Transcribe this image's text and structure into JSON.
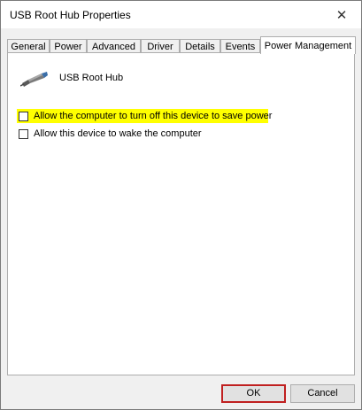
{
  "window": {
    "title": "USB Root Hub Properties",
    "close_glyph": "✕"
  },
  "tabs": [
    {
      "label": "General",
      "active": false
    },
    {
      "label": "Power",
      "active": false
    },
    {
      "label": "Advanced",
      "active": false
    },
    {
      "label": "Driver",
      "active": false
    },
    {
      "label": "Details",
      "active": false
    },
    {
      "label": "Events",
      "active": false
    },
    {
      "label": "Power Management",
      "active": true
    }
  ],
  "device": {
    "name": "USB Root Hub",
    "icon": "usb-plug-icon"
  },
  "options": [
    {
      "label": "Allow the computer to turn off this device to save power",
      "checked": false,
      "highlighted": true
    },
    {
      "label": "Allow this device to wake the computer",
      "checked": false,
      "highlighted": false
    }
  ],
  "buttons": {
    "ok_label": "OK",
    "cancel_label": "Cancel"
  },
  "colors": {
    "highlight": "#ffff00",
    "default_button_border": "#c02020"
  }
}
